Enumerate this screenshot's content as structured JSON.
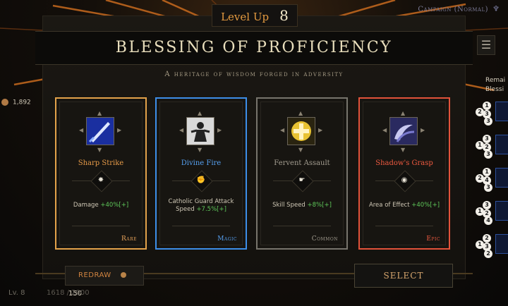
{
  "header": {
    "level_up_label": "Level Up",
    "level_value": "8",
    "campaign_label": "Campaign (Normal)"
  },
  "title": "BLESSING OF PROFICIENCY",
  "subtitle": "A heritage of wisdom forged in adversity",
  "gold": "1,892",
  "remaining": {
    "label_line1": "Remai",
    "label_line2": "Blessi",
    "slots": [
      {
        "nums": [
          "2",
          "1",
          "3",
          "3"
        ]
      },
      {
        "nums": [
          "1",
          "3",
          "2",
          "3"
        ]
      },
      {
        "nums": [
          "2",
          "1",
          "4",
          "3"
        ]
      },
      {
        "nums": [
          "1",
          "3",
          "2",
          "4"
        ]
      },
      {
        "nums": [
          "1",
          "2",
          "3",
          "2"
        ]
      }
    ]
  },
  "cards": [
    {
      "name": "Sharp Strike",
      "stat_label": "Damage",
      "stat_value": "+40%[+]",
      "rarity": "Rare",
      "name_color": "#e69a48",
      "rarity_color": "#e6a25a",
      "stat_icon": "burst-icon",
      "skill_icon": "sword-slash-icon"
    },
    {
      "name": "Divine Fire",
      "stat_label": "Catholic Guard Attack Speed",
      "stat_value": "+7.5%[+]",
      "rarity": "Magic",
      "name_color": "#56a0f0",
      "rarity_color": "#56a0f0",
      "stat_icon": "fist-icon",
      "skill_icon": "guard-figure-icon"
    },
    {
      "name": "Fervent Assault",
      "stat_label": "Skill Speed",
      "stat_value": "+8%[+]",
      "rarity": "Common",
      "name_color": "#a39d90",
      "rarity_color": "#a39d90",
      "stat_icon": "fast-hand-icon",
      "skill_icon": "holy-cross-icon"
    },
    {
      "name": "Shadow's Grasp",
      "stat_label": "Area of Effect",
      "stat_value": "+40%[+]",
      "rarity": "Epic",
      "name_color": "#ef5a40",
      "rarity_color": "#ef5a40",
      "stat_icon": "area-eye-icon",
      "skill_icon": "shadow-claw-icon"
    }
  ],
  "redraw": {
    "label": "REDRAW",
    "cost": "150"
  },
  "select_label": "SELECT",
  "footer": {
    "level": "Lv. 8",
    "xp": "1618 / 2000"
  }
}
